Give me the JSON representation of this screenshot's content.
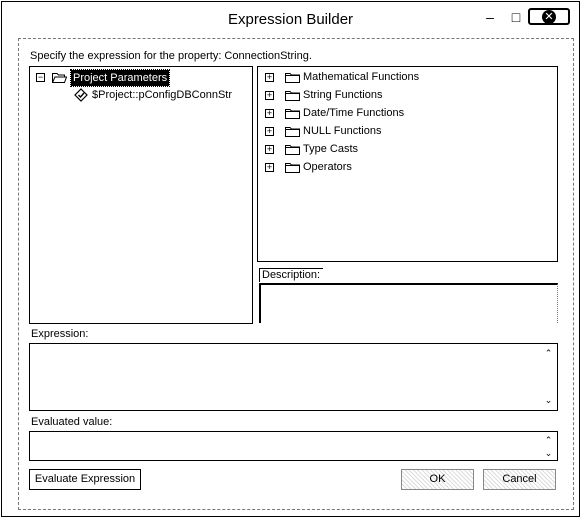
{
  "window": {
    "title": "Expression Builder"
  },
  "prompt": "Specify the expression for the property: ConnectionString.",
  "left_tree": {
    "root": {
      "expander": "−",
      "label": "Project Parameters",
      "selected": true
    },
    "children": [
      {
        "label": "$Project::pConfigDBConnStr"
      }
    ]
  },
  "right_tree": {
    "items": [
      {
        "expander": "+",
        "label": "Mathematical Functions"
      },
      {
        "expander": "+",
        "label": "String Functions"
      },
      {
        "expander": "+",
        "label": "Date/Time Functions"
      },
      {
        "expander": "+",
        "label": "NULL Functions"
      },
      {
        "expander": "+",
        "label": "Type Casts"
      },
      {
        "expander": "+",
        "label": "Operators"
      }
    ]
  },
  "description": {
    "label": "Description:",
    "value": ""
  },
  "expression": {
    "label": "Expression:",
    "value": ""
  },
  "evaluated": {
    "label": "Evaluated value:",
    "value": ""
  },
  "buttons": {
    "evaluate": "Evaluate Expression",
    "ok": "OK",
    "cancel": "Cancel"
  },
  "titlebar_glyphs": {
    "minimize": "–",
    "maximize": "□",
    "close": "✕"
  }
}
